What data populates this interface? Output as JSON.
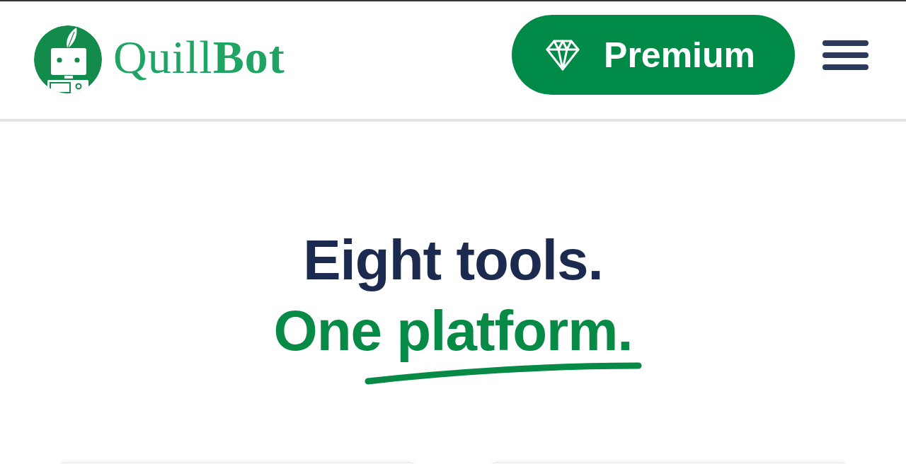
{
  "header": {
    "logo": {
      "text": "Quill**Bot**"
    },
    "premium_button": {
      "label": "Premium"
    }
  },
  "hero": {
    "headline_lines": [
      {
        "text": "Eight tools.",
        "kind": "plain"
      },
      {
        "text": "One platform.",
        "kind": "underlined"
      }
    ]
  }
}
